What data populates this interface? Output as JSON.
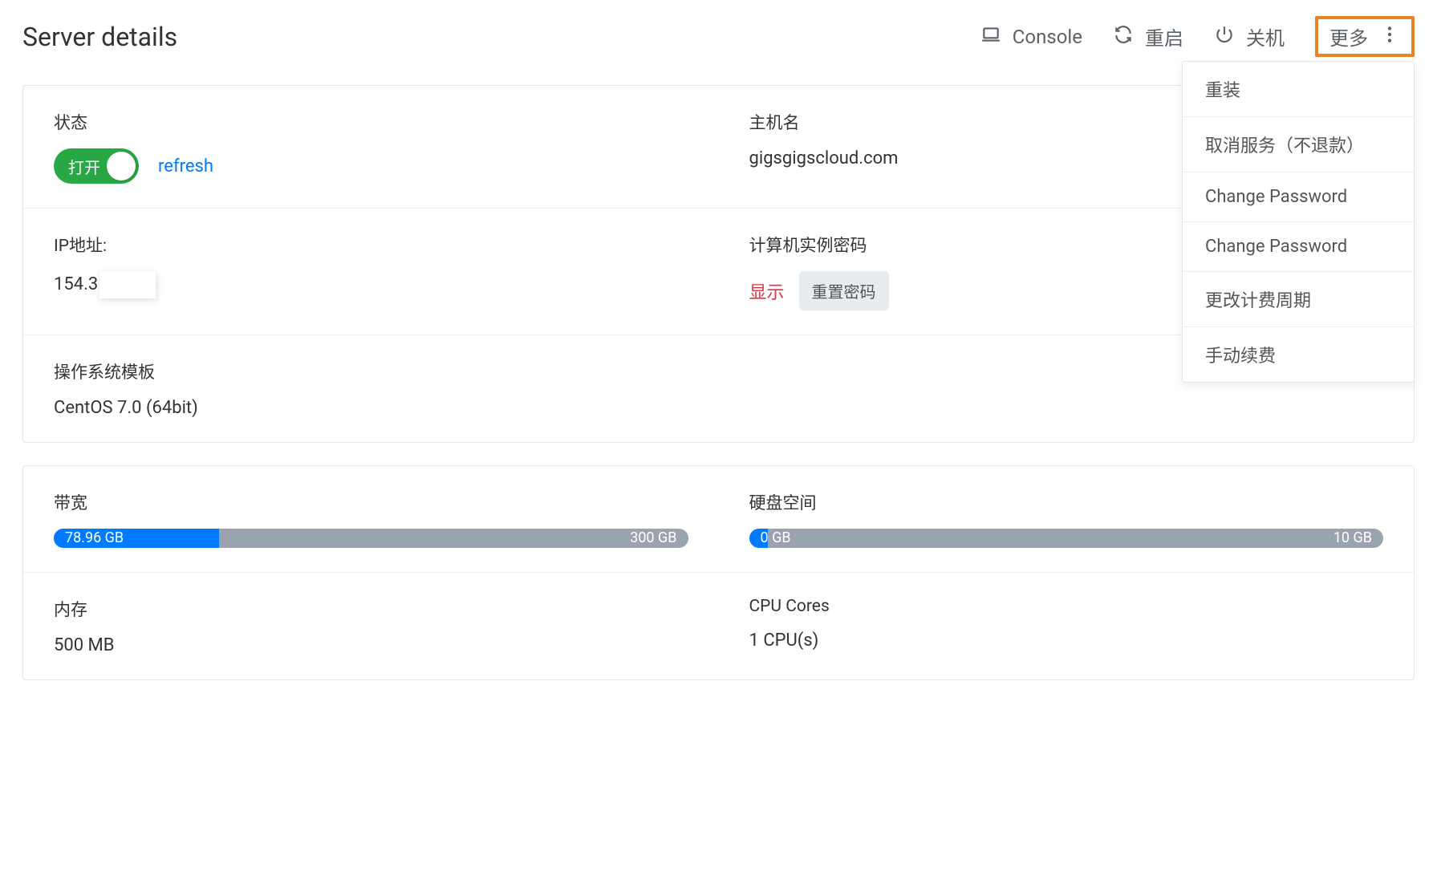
{
  "header": {
    "title": "Server details",
    "actions": {
      "console": "Console",
      "restart": "重启",
      "shutdown": "关机",
      "more": "更多"
    }
  },
  "dropdown": {
    "items": [
      "重装",
      "取消服务（不退款）",
      "Change Password",
      "Change Password",
      "更改计费周期",
      "手动续费"
    ]
  },
  "details": {
    "status_label": "状态",
    "toggle_label": "打开",
    "refresh": "refresh",
    "hostname_label": "主机名",
    "hostname_value": "gigsgigscloud.com",
    "ip_label": "IP地址:",
    "ip_prefix": "154.3",
    "password_label": "计算机实例密码",
    "show": "显示",
    "reset": "重置密码",
    "os_label": "操作系统模板",
    "os_value": "CentOS 7.0 (64bit)"
  },
  "resources": {
    "bandwidth_label": "带宽",
    "bandwidth_used": "78.96 GB",
    "bandwidth_total": "300 GB",
    "bandwidth_pct": 26,
    "disk_label": "硬盘空间",
    "disk_used": "0 GB",
    "disk_total": "10 GB",
    "disk_pct": 3,
    "memory_label": "内存",
    "memory_value": "500 MB",
    "cpu_label": "CPU Cores",
    "cpu_value": "1 CPU(s)"
  }
}
